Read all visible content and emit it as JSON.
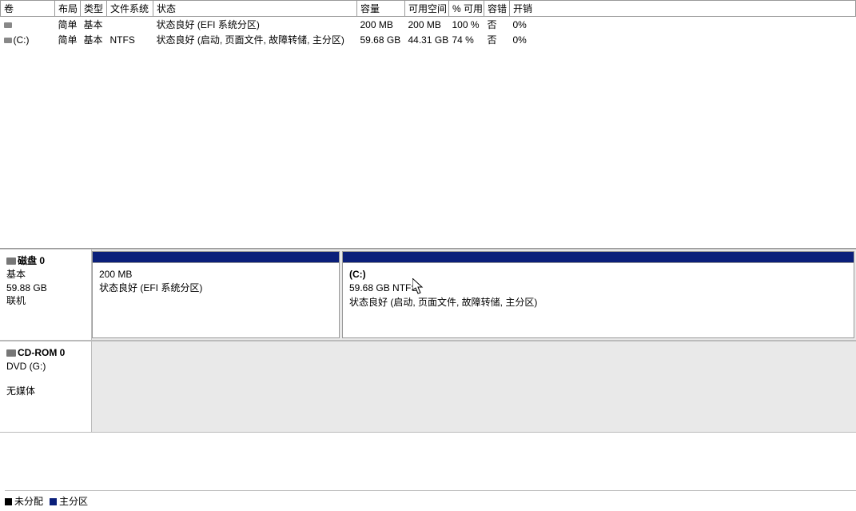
{
  "columns": {
    "volume": "卷",
    "layout": "布局",
    "type": "类型",
    "filesystem": "文件系统",
    "status": "状态",
    "capacity": "容量",
    "free": "可用空间",
    "pct_free": "% 可用",
    "fault": "容错",
    "overhead": "开销"
  },
  "volumes": [
    {
      "name": "",
      "layout": "简单",
      "type": "基本",
      "filesystem": "",
      "status": "状态良好 (EFI 系统分区)",
      "capacity": "200 MB",
      "free": "200 MB",
      "pct_free": "100 %",
      "fault": "否",
      "overhead": "0%"
    },
    {
      "name": "(C:)",
      "layout": "简单",
      "type": "基本",
      "filesystem": "NTFS",
      "status": "状态良好 (启动, 页面文件, 故障转储, 主分区)",
      "capacity": "59.68 GB",
      "free": "44.31 GB",
      "pct_free": "74 %",
      "fault": "否",
      "overhead": "0%"
    }
  ],
  "disk0": {
    "name": "磁盘 0",
    "type": "基本",
    "size": "59.88 GB",
    "state": "联机",
    "partitions": [
      {
        "title": "",
        "size_line": "200 MB",
        "status_line": "状态良好 (EFI 系统分区)"
      },
      {
        "title": "(C:)",
        "size_line": "59.68 GB NTFS",
        "status_line": "状态良好 (启动, 页面文件, 故障转储, 主分区)"
      }
    ]
  },
  "cdrom": {
    "name": "CD-ROM 0",
    "drive": "DVD (G:)",
    "state": "无媒体"
  },
  "legend": {
    "unallocated": "未分配",
    "primary": "主分区"
  }
}
